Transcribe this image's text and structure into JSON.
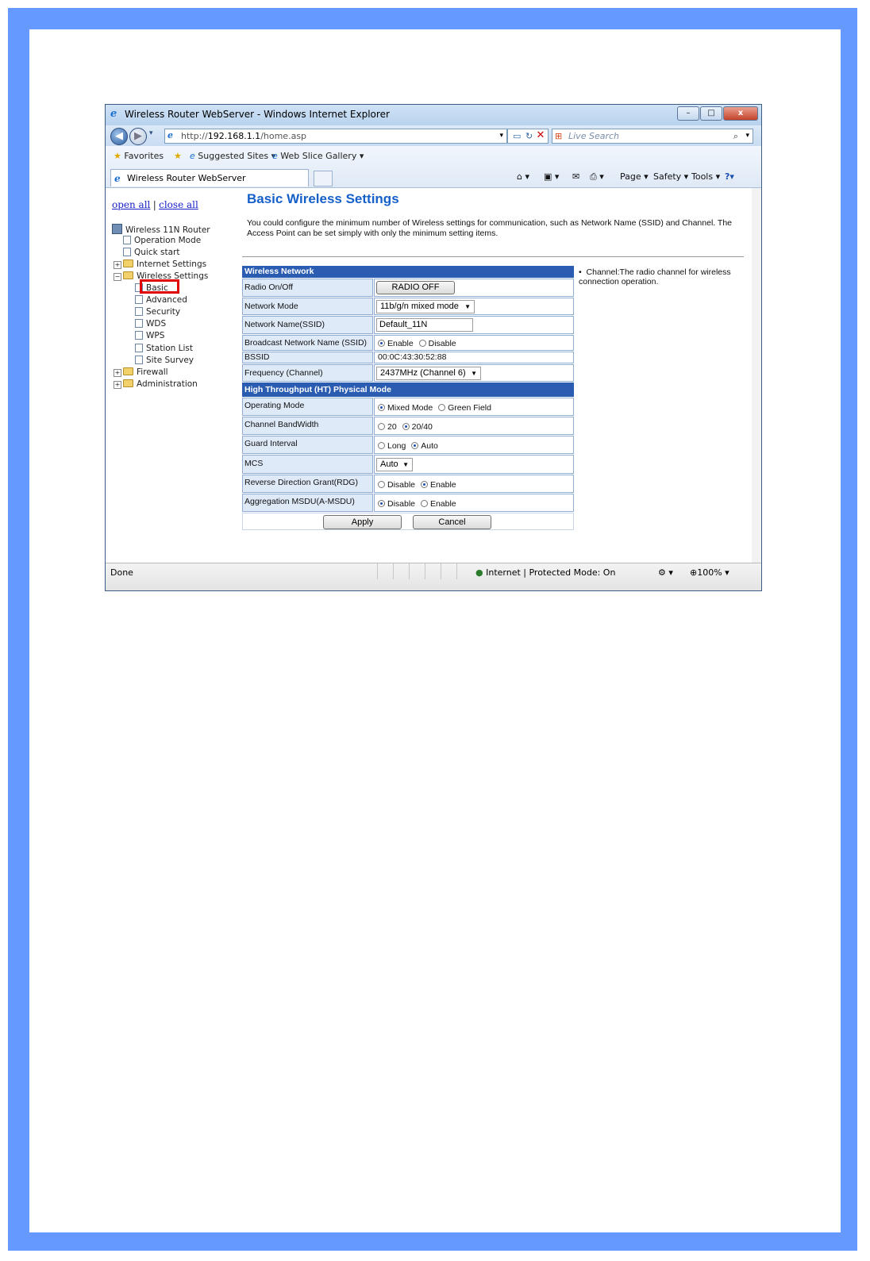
{
  "window": {
    "title": "Wireless Router WebServer - Windows Internet Explorer",
    "controls": {
      "minimize": "–",
      "maximize": "□",
      "close": "x"
    }
  },
  "address_bar": {
    "url_prefix": "http://",
    "url_host": "192.168.1.1",
    "url_path": "/home.asp",
    "search_placeholder": "Live Search"
  },
  "favorites_bar": {
    "favorites": "Favorites",
    "suggested_sites": "Suggested Sites ▾",
    "web_slice_gallery": "Web Slice Gallery ▾"
  },
  "tab": {
    "label": "Wireless Router WebServer"
  },
  "command_bar": {
    "page": "Page ▾",
    "safety": "Safety ▾",
    "tools": "Tools ▾",
    "help": "?▾"
  },
  "tree": {
    "open_all": "open all",
    "separator": "|",
    "close_all": "close all",
    "root": "Wireless 11N Router",
    "items": [
      {
        "label": "Operation Mode"
      },
      {
        "label": "Quick start"
      },
      {
        "label": "Internet Settings"
      },
      {
        "label": "Wireless Settings"
      },
      {
        "label": "Basic"
      },
      {
        "label": "Advanced"
      },
      {
        "label": "Security"
      },
      {
        "label": "WDS"
      },
      {
        "label": "WPS"
      },
      {
        "label": "Station List"
      },
      {
        "label": "Site Survey"
      },
      {
        "label": "Firewall"
      },
      {
        "label": "Administration"
      }
    ]
  },
  "main": {
    "title": "Basic Wireless Settings",
    "intro": "You could configure the minimum number of Wireless settings for communication, such as Network Name (SSID) and Channel. The Access Point can be set simply with only the minimum setting items.",
    "section_wireless": "Wireless Network",
    "radio_label": "Radio On/Off",
    "radio_button": "RADIO OFF",
    "network_mode_label": "Network Mode",
    "network_mode_value": "11b/g/n mixed mode",
    "ssid_label": "Network Name(SSID)",
    "ssid_value": "Default_11N",
    "broadcast_label": "Broadcast Network Name (SSID)",
    "broadcast_enable": "Enable",
    "broadcast_disable": "Disable",
    "bssid_label": "BSSID",
    "bssid_value": "00:0C:43:30:52:88",
    "frequency_label": "Frequency (Channel)",
    "frequency_value": "2437MHz (Channel 6)",
    "section_ht": "High Throughput (HT) Physical Mode",
    "opmode_label": "Operating Mode",
    "opmode_mixed": "Mixed Mode",
    "opmode_green": "Green Field",
    "bw_label": "Channel BandWidth",
    "bw_20": "20",
    "bw_2040": "20/40",
    "gi_label": "Guard Interval",
    "gi_long": "Long",
    "gi_auto": "Auto",
    "mcs_label": "MCS",
    "mcs_value": "Auto",
    "rdg_label": "Reverse Direction Grant(RDG)",
    "rdg_disable": "Disable",
    "rdg_enable": "Enable",
    "amsdu_label": "Aggregation MSDU(A-MSDU)",
    "amsdu_disable": "Disable",
    "amsdu_enable": "Enable",
    "apply": "Apply",
    "cancel": "Cancel",
    "help_text": "Channel:The radio channel for wireless connection operation."
  },
  "status_bar": {
    "done": "Done",
    "zone": "Internet | Protected Mode: On",
    "zoom": "100%"
  }
}
